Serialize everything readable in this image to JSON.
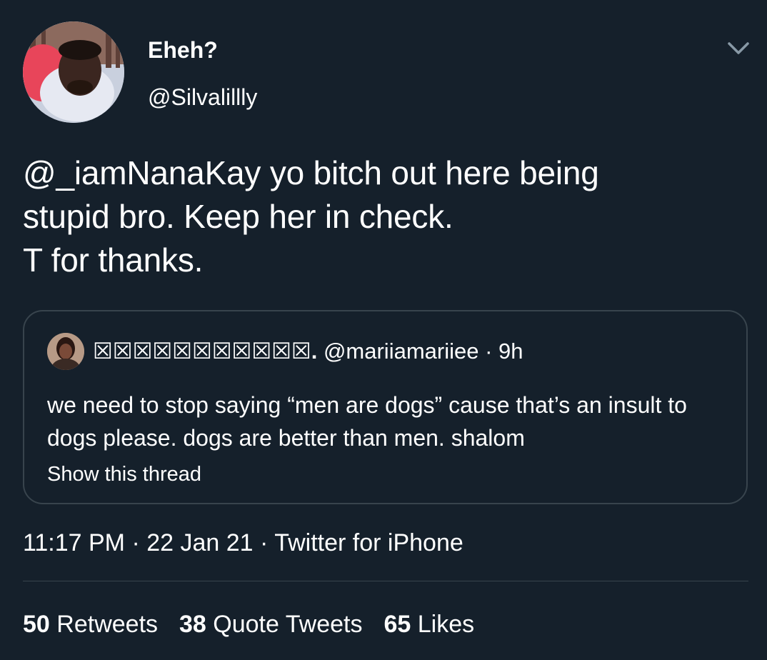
{
  "author": {
    "display_name": "Eheh?",
    "handle": "@Silvalillly"
  },
  "tweet": {
    "text": "@_iamNanaKay yo bitch out here being\nstupid bro. Keep her in check.\nT for thanks."
  },
  "quoted_tweet": {
    "display_name": "☒☒☒☒☒☒☒☒☒☒☒.",
    "handle": "@mariiamariiee",
    "separator": " · ",
    "time": "9h",
    "text": "we need to stop saying “men are dogs” cause that’s an insult to dogs please. dogs are better than men. shalom",
    "show_thread": "Show this thread"
  },
  "meta": {
    "time": "11:17 PM",
    "date": "22 Jan 21",
    "source": "Twitter for iPhone",
    "separator": " · "
  },
  "stats": {
    "retweets_count": "50",
    "retweets_label": "Retweets",
    "quotes_count": "38",
    "quotes_label": "Quote Tweets",
    "likes_count": "65",
    "likes_label": "Likes"
  },
  "colors": {
    "background": "#15202b",
    "border": "#38444d",
    "text": "#ffffff",
    "caret": "#8899a6"
  },
  "icons": {
    "caret": "chevron-down-icon"
  }
}
